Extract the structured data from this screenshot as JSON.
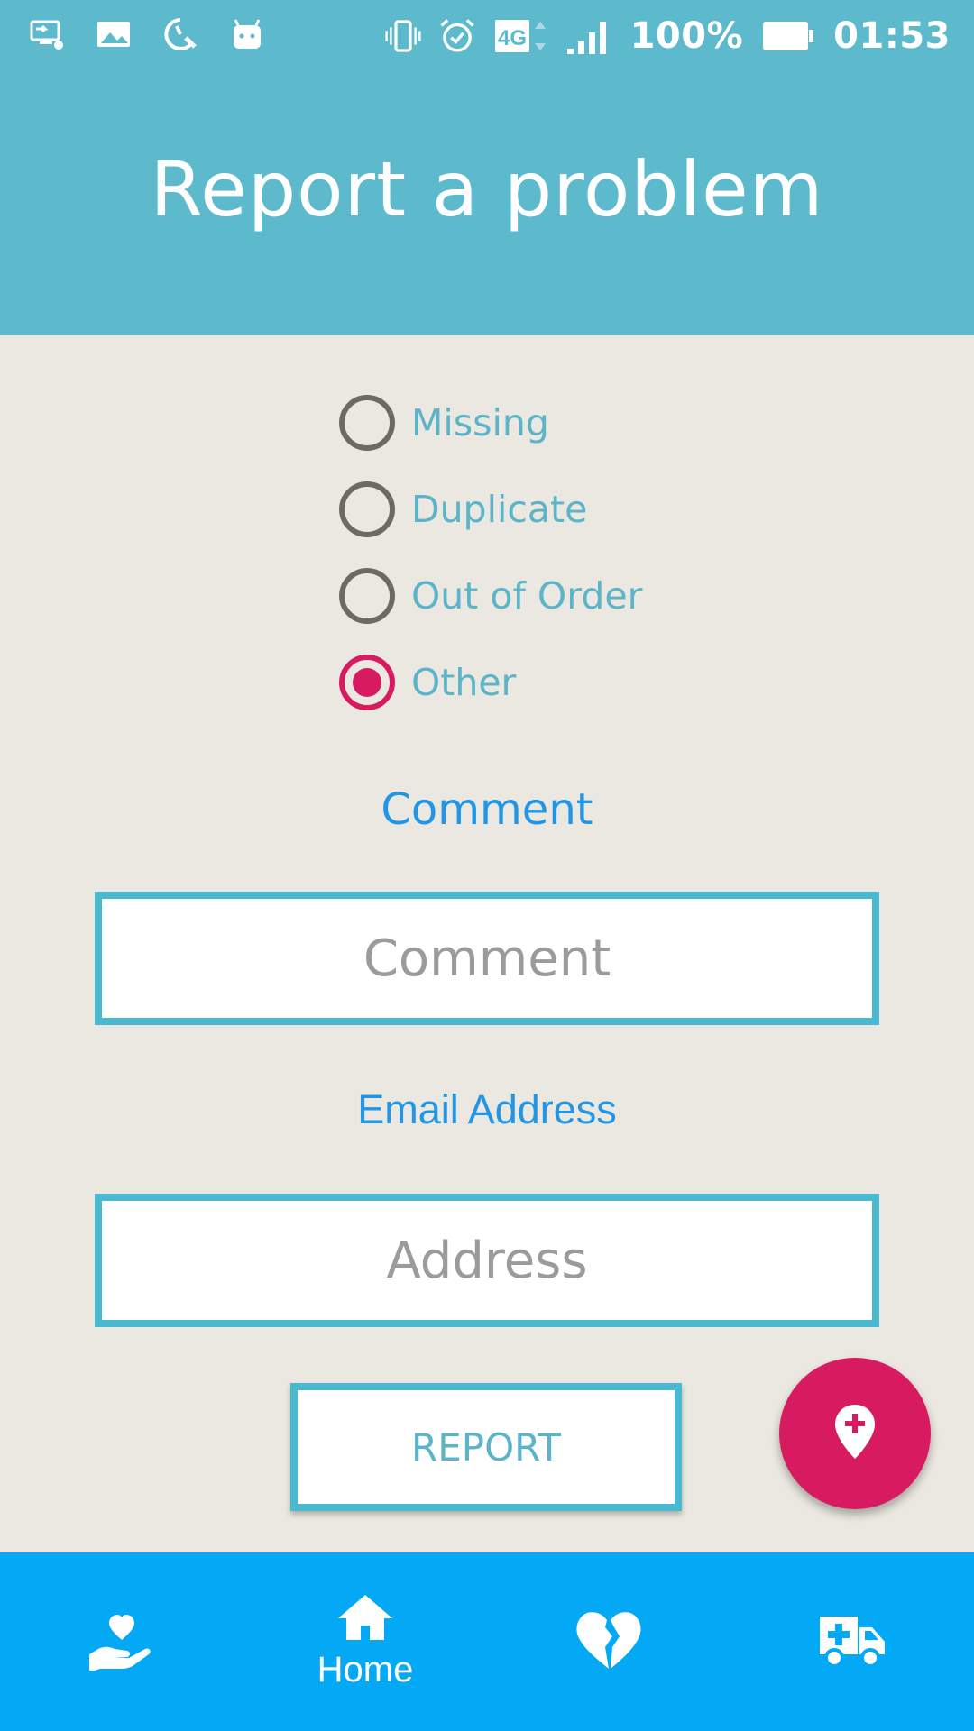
{
  "status_bar": {
    "battery": "100%",
    "time": "01:53",
    "network": "4G",
    "left_icons": [
      "screen-cast-icon",
      "image-icon",
      "speed-settings-icon",
      "android-icon"
    ],
    "right_icons": [
      "vibrate-icon",
      "alarm-icon",
      "network-4g-icon",
      "signal-icon",
      "battery-icon"
    ]
  },
  "header": {
    "title": "Report a problem",
    "background": "#5dbacd"
  },
  "problem_types": {
    "options": [
      {
        "label": "Missing",
        "checked": false
      },
      {
        "label": "Duplicate",
        "checked": false
      },
      {
        "label": "Out of Order",
        "checked": false
      },
      {
        "label": "Other",
        "checked": true
      }
    ]
  },
  "comment": {
    "label": "Comment",
    "placeholder": "Comment",
    "value": ""
  },
  "email": {
    "label": "Email Address",
    "placeholder": "Address",
    "value": ""
  },
  "report_button": {
    "label": "REPORT"
  },
  "fab": {
    "icon": "map-marker-plus-icon",
    "color": "#d81b60"
  },
  "bottom_nav": {
    "items": [
      {
        "icon": "hand-heart-icon",
        "label": ""
      },
      {
        "icon": "home-icon",
        "label": "Home"
      },
      {
        "icon": "broken-heart-icon",
        "label": ""
      },
      {
        "icon": "ambulance-icon",
        "label": ""
      }
    ],
    "background": "#03a9f4"
  },
  "colors": {
    "accent": "#d81b60",
    "teal": "#4ab9cf",
    "label_blue": "#2196e6",
    "page_background": "#ebe8e1"
  }
}
